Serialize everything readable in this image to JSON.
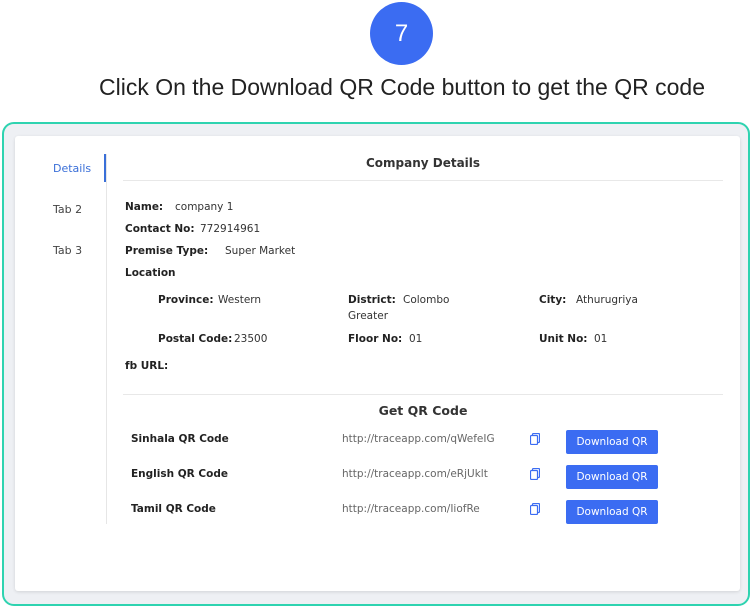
{
  "step": {
    "number": "7"
  },
  "instruction": "Click On the Download QR Code button to get the QR code",
  "tabs": [
    {
      "label": "Details",
      "active": true
    },
    {
      "label": "Tab 2",
      "active": false
    },
    {
      "label": "Tab 3",
      "active": false
    }
  ],
  "company": {
    "title": "Company Details",
    "name_label": "Name:",
    "name": "company 1",
    "contact_label": "Contact No:",
    "contact": "772914961",
    "premise_label": "Premise Type:",
    "premise": "Super Market",
    "location_label": "Location",
    "province_label": "Province:",
    "province": "Western",
    "district_label": "District:",
    "district": "Colombo Greater",
    "city_label": "City:",
    "city": "Athurugriya",
    "postal_label": "Postal Code:",
    "postal": "23500",
    "floor_label": "Floor No:",
    "floor": "01",
    "unit_label": "Unit No:",
    "unit": "01",
    "fb_label": "fb URL:"
  },
  "qr": {
    "title": "Get QR Code",
    "button_label": "Download QR",
    "items": [
      {
        "name": "Sinhala QR Code",
        "url": "http://traceapp.com/qWefeIG"
      },
      {
        "name": "English QR Code",
        "url": "http://traceapp.com/eRjUklt"
      },
      {
        "name": "Tamil QR Code",
        "url": "http://traceapp.com/IiofRe"
      }
    ]
  },
  "colors": {
    "accent": "#3b6cf2",
    "frame": "#2ed3b0",
    "tab_active": "#3a6fd8"
  },
  "icons": {
    "copy": "copy-icon"
  }
}
